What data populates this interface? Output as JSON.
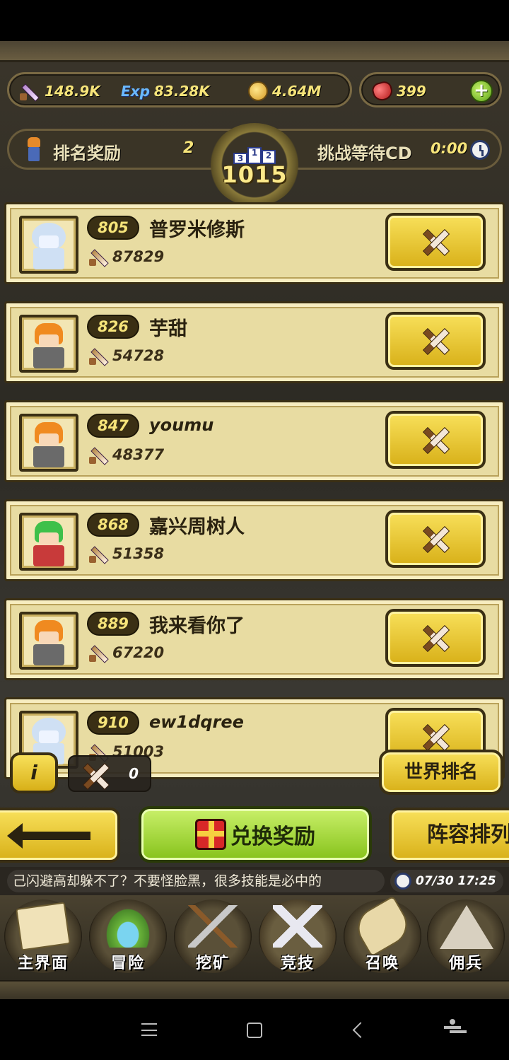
{
  "resources": {
    "attack": "148.9K",
    "exp_label": "Exp",
    "exp": "83.28K",
    "gold": "4.64M",
    "gems": "399",
    "add_symbol": "+"
  },
  "rank_header": {
    "reward_label": "排名奖励",
    "reward_count": "2",
    "cd_label": "挑战等待CD",
    "cd_time": "0:00",
    "my_rank": "1015",
    "podium": [
      "3",
      "1",
      "2"
    ]
  },
  "opponents": [
    {
      "rank": "805",
      "name": "普罗米修斯",
      "power": "87829",
      "avatar": "bear"
    },
    {
      "rank": "826",
      "name": "芋甜",
      "power": "54728",
      "avatar": "orange"
    },
    {
      "rank": "847",
      "name": "youmu",
      "power": "48377",
      "avatar": "orange"
    },
    {
      "rank": "868",
      "name": "嘉兴周树人",
      "power": "51358",
      "avatar": "green"
    },
    {
      "rank": "889",
      "name": "我来看你了",
      "power": "67220",
      "avatar": "orange"
    },
    {
      "rank": "910",
      "name": "ew1dqree",
      "power": "51003",
      "avatar": "bear"
    }
  ],
  "controls": {
    "info_label": "i",
    "fight_count": "0",
    "world_rank_label": "世界排名",
    "exchange_label": "兑换奖励",
    "lineup_label": "阵容排列"
  },
  "ticker": {
    "message": "己闪避高却躲不了？不要怪脸黑，很多技能是必中的",
    "datetime": "07/30 17:25"
  },
  "nav": [
    {
      "label": "主界面",
      "icon": "map-scroll-icon"
    },
    {
      "label": "冒险",
      "icon": "island-icon"
    },
    {
      "label": "挖矿",
      "icon": "pickaxe-icon"
    },
    {
      "label": "竞技",
      "icon": "crossed-swords-icon"
    },
    {
      "label": "召唤",
      "icon": "summon-scroll-icon"
    },
    {
      "label": "佣兵",
      "icon": "tent-icon"
    }
  ]
}
